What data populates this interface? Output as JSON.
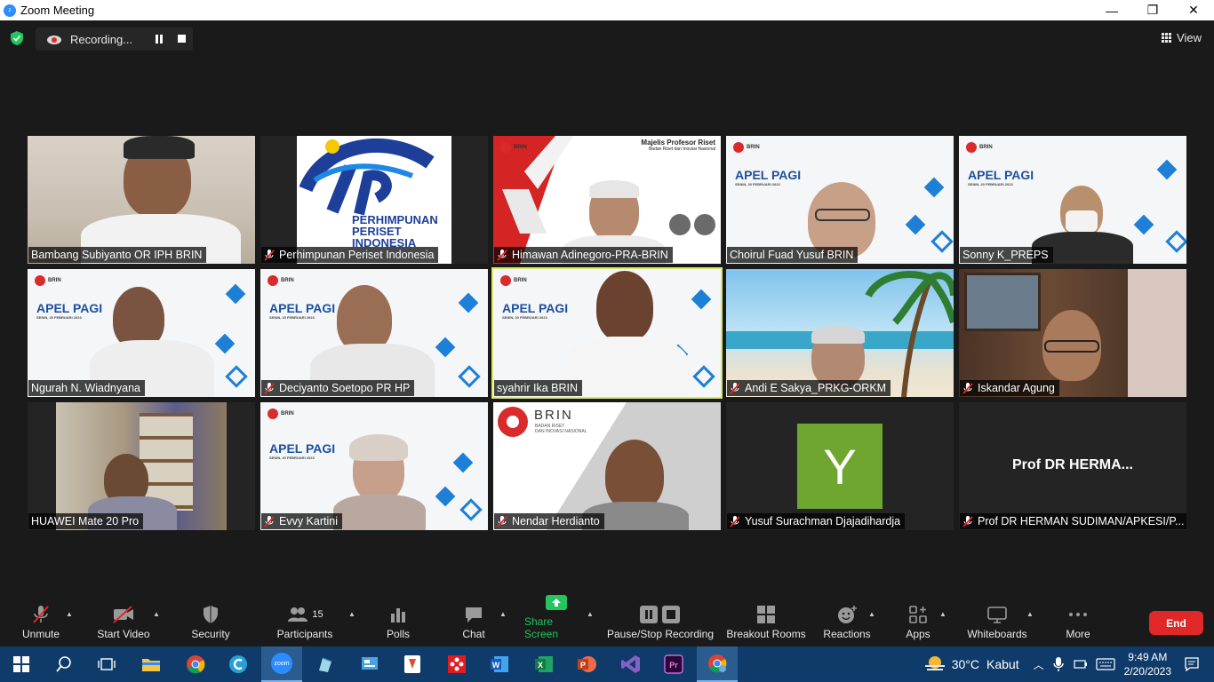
{
  "window": {
    "title": "Zoom Meeting",
    "minimize_glyph": "—",
    "maximize_glyph": "❐",
    "close_glyph": "✕"
  },
  "recording": {
    "label": "Recording..."
  },
  "view_button": {
    "label": "View"
  },
  "participants_tiles": [
    {
      "name": "Bambang Subiyanto OR IPH BRIN",
      "muted": false
    },
    {
      "name": "Perhimpunan Periset Indonesia",
      "muted": true
    },
    {
      "name": "Himawan Adinegoro-PRA-BRIN",
      "muted": true
    },
    {
      "name": "Choirul Fuad Yusuf BRIN",
      "muted": false
    },
    {
      "name": "Sonny K_PREPS",
      "muted": false
    },
    {
      "name": "Ngurah N. Wiadnyana",
      "muted": false
    },
    {
      "name": "Deciyanto Soetopo PR HP",
      "muted": true
    },
    {
      "name": "syahrir Ika BRIN",
      "muted": false
    },
    {
      "name": "Andi E Sakya_PRKG-ORKM",
      "muted": true
    },
    {
      "name": "Iskandar Agung",
      "muted": true
    },
    {
      "name": "HUAWEI Mate 20 Pro",
      "muted": false
    },
    {
      "name": "Evvy Kartini",
      "muted": true
    },
    {
      "name": "Nendar Herdianto",
      "muted": true
    },
    {
      "name": "Yusuf Surachman Djajadihardja",
      "muted": true
    },
    {
      "name": "Prof DR HERMAN SUDIMAN/APKESI/P...",
      "muted": true
    }
  ],
  "tile_content": {
    "org_logo_text": "PERHIMPUNAN\nPERISET\nINDONESIA",
    "banner_title": "APEL PAGI",
    "banner_date": "SENIN, 20 FEBRUARI 2023",
    "brin_label": "BRIN",
    "brin_subtitle": "BADAN RISET\nDAN INOVASI NASIONAL",
    "mpr_title": "Majelis Profesor Riset",
    "mpr_subtitle": "Badan Riset dan Inovasi Nasional",
    "avatar_letter": "Y",
    "avatar_color": "#6fa62f",
    "name_display": "Prof DR HERMA..."
  },
  "toolbar": {
    "unmute": "Unmute",
    "start_video": "Start Video",
    "security": "Security",
    "participants": "Participants",
    "participants_count": "15",
    "polls": "Polls",
    "chat": "Chat",
    "share_screen": "Share Screen",
    "pause_stop_recording": "Pause/Stop Recording",
    "breakout_rooms": "Breakout Rooms",
    "reactions": "Reactions",
    "apps": "Apps",
    "whiteboards": "Whiteboards",
    "more": "More",
    "end": "End"
  },
  "taskbar": {
    "weather_temp": "30°C",
    "weather_desc": "Kabut",
    "time": "9:49 AM",
    "date": "2/20/2023",
    "zoom_label": "zoom"
  },
  "colors": {
    "accent_green": "#22c55e",
    "end_red": "#e02828",
    "taskbar_blue": "#0f3b6b",
    "active_speaker": "#d9e86a"
  }
}
